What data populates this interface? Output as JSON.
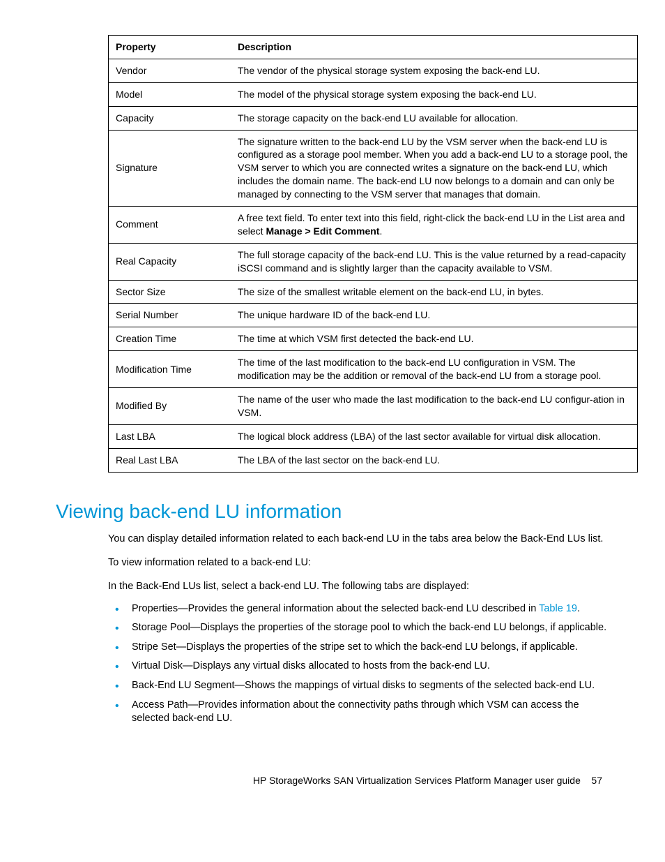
{
  "table": {
    "headers": {
      "col1": "Property",
      "col2": "Description"
    },
    "rows": [
      {
        "prop": "Vendor",
        "desc": "The vendor of the physical storage system exposing the back-end LU."
      },
      {
        "prop": "Model",
        "desc": "The model of the physical storage system exposing the back-end LU."
      },
      {
        "prop": "Capacity",
        "desc": "The storage capacity on the back-end LU available for allocation."
      },
      {
        "prop": "Signature",
        "desc": "The signature written to the back-end LU by the VSM server when the back-end LU is configured as a storage pool member. When you add a back-end LU to a storage pool, the VSM server to which you are connected writes a signature on the back-end LU, which includes the domain name. The back-end LU now belongs to a domain and can only be managed by connecting to the VSM server that manages that domain."
      },
      {
        "prop": "Comment",
        "desc_pre": "A free text field. To enter text into this field, right-click the back-end LU in the List area and select ",
        "desc_bold": "Manage > Edit Comment",
        "desc_post": "."
      },
      {
        "prop": "Real Capacity",
        "desc": "The full storage capacity of the back-end LU. This is the value returned by a read-capacity iSCSI command and is slightly larger than the capacity available to VSM."
      },
      {
        "prop": "Sector Size",
        "desc": "The size of the smallest writable element on the back-end LU, in bytes."
      },
      {
        "prop": "Serial Number",
        "desc": "The unique hardware ID of the back-end LU."
      },
      {
        "prop": "Creation Time",
        "desc": "The time at which VSM first detected the back-end LU."
      },
      {
        "prop": "Modification Time",
        "desc": "The time of the last modification to the back-end LU configuration in VSM. The modification may be the addition or removal of the back-end LU from a storage pool."
      },
      {
        "prop": "Modified By",
        "desc": "The name of the user who made the last modification to the back-end LU configur-ation in VSM."
      },
      {
        "prop": "Last LBA",
        "desc": "The logical block address (LBA) of the last sector available for virtual disk allocation."
      },
      {
        "prop": "Real Last LBA",
        "desc": "The LBA of the last sector on the back-end LU."
      }
    ]
  },
  "section_heading": "Viewing back-end LU information",
  "paragraphs": {
    "p1": "You can display detailed information related to each back-end LU in the tabs area below the Back-End LUs list.",
    "p2": "To view information related to a back-end LU:",
    "p3": "In the Back-End LUs list, select a back-end LU. The following tabs are displayed:"
  },
  "bullets": [
    {
      "pre": "Properties—Provides the general information about the selected back-end LU described in ",
      "link": "Table 19",
      "post": "."
    },
    {
      "text": "Storage Pool—Displays the properties of the storage pool to which the back-end LU belongs, if applicable."
    },
    {
      "text": "Stripe Set—Displays the properties of the stripe set to which the back-end LU belongs, if applicable."
    },
    {
      "text": "Virtual Disk—Displays any virtual disks allocated to hosts from the back-end LU."
    },
    {
      "text": "Back-End LU Segment—Shows the mappings of virtual disks to segments of the selected back-end LU."
    },
    {
      "text": "Access Path—Provides information about the connectivity paths through which VSM can access the selected back-end LU."
    }
  ],
  "footer": {
    "title": "HP StorageWorks SAN Virtualization Services Platform Manager user guide",
    "page": "57"
  }
}
